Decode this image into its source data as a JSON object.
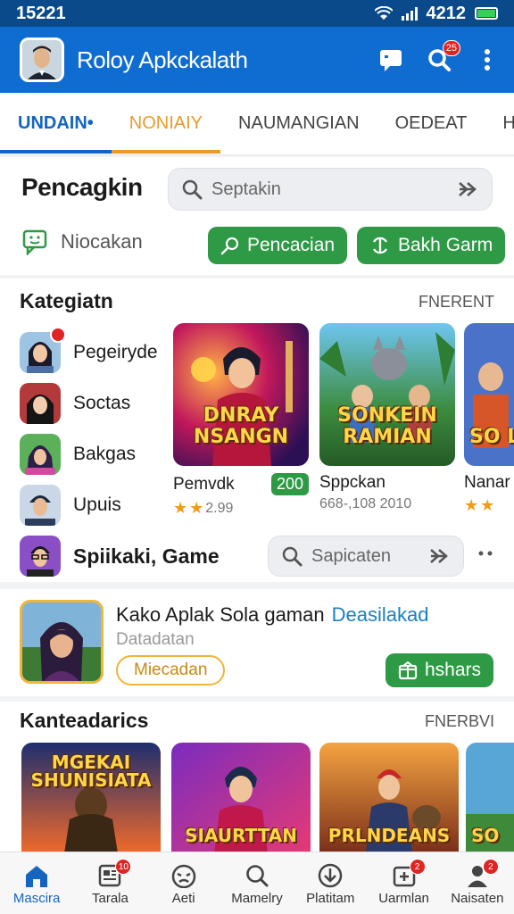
{
  "status_bar": {
    "time": "15221",
    "right_text": "4212"
  },
  "app_bar": {
    "title": "Roloy Apkckalath",
    "search_badge": "25"
  },
  "tabs": [
    {
      "label": "UNDAIN•"
    },
    {
      "label": "NONIAIY"
    },
    {
      "label": "NAUMANGIAN"
    },
    {
      "label": "OEDEAT"
    },
    {
      "label": "HOM"
    }
  ],
  "search_section": {
    "heading": "Pencagkin",
    "search_placeholder": "Septakin",
    "chat_label": "Niocakan",
    "btn_search": "Pencacian",
    "btn_back": "Bakh Garm"
  },
  "categories": {
    "title": "Kategiatn",
    "more": "FNERENT",
    "items": [
      {
        "label": "Pegeiryde"
      },
      {
        "label": "Soctas"
      },
      {
        "label": "Bakgas"
      },
      {
        "label": "Upuis"
      }
    ],
    "cards": [
      {
        "art_title": "DNRAY NSANGN",
        "name": "Pemvdk",
        "value": "200",
        "meta": "2.99"
      },
      {
        "art_title": "SONKEIN RAMIAN",
        "name": "Sppckan",
        "meta": "668-,108 2010"
      },
      {
        "art_title": "SO LA",
        "name": "Nanar",
        "meta": ""
      }
    ],
    "game_row_label": "Spiikaki, Game",
    "game_search_placeholder": "Sapicaten"
  },
  "featured": {
    "title": "Kako Aplak Sola gaman",
    "title_accent": "Deasilakad",
    "subtitle": "Datadatan",
    "outline_btn": "Miecadan",
    "green_btn": "hshars"
  },
  "bottom_category": {
    "title": "Kanteadarics",
    "more": "FNERBVI",
    "cards": [
      {
        "art_title": "MGEKAI SHUNISIATA"
      },
      {
        "art_title": "SIAURTTAN"
      },
      {
        "art_title": "PRLNDEANS"
      },
      {
        "art_title": "SO"
      }
    ]
  },
  "bottom_nav": [
    {
      "label": "Mascira",
      "icon": "home-icon"
    },
    {
      "label": "Tarala",
      "icon": "news-icon",
      "badge": "10"
    },
    {
      "label": "Aeti",
      "icon": "gauge-icon"
    },
    {
      "label": "Mamelry",
      "icon": "search-icon"
    },
    {
      "label": "Platitam",
      "icon": "download-icon"
    },
    {
      "label": "Uarmlan",
      "icon": "add-app-icon",
      "badge": "2"
    },
    {
      "label": "Naisaten",
      "icon": "profile-icon",
      "badge": "2"
    }
  ],
  "colors": {
    "primary": "#0f6cd0",
    "green": "#2f9a45",
    "accent_orange": "#e89b2c",
    "badge_red": "#e02424"
  }
}
